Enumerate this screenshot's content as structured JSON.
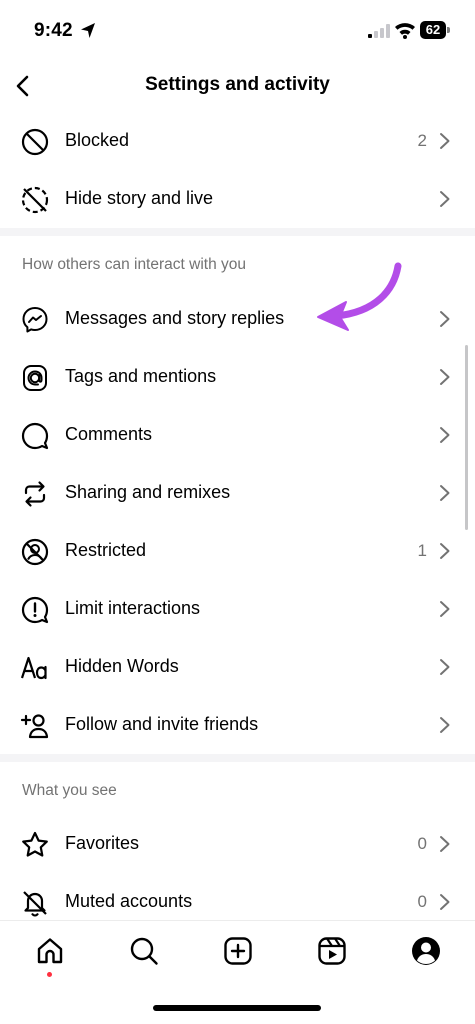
{
  "status_bar": {
    "time": "9:42",
    "battery": "62"
  },
  "header": {
    "title": "Settings and activity"
  },
  "top_rows": [
    {
      "label": "Blocked",
      "count": "2",
      "icon": "blocked-icon"
    },
    {
      "label": "Hide story and live",
      "count": "",
      "icon": "hide-story-icon"
    }
  ],
  "sections": [
    {
      "title": "How others can interact with you",
      "items": [
        {
          "label": "Messages and story replies",
          "count": "",
          "icon": "messenger-icon"
        },
        {
          "label": "Tags and mentions",
          "count": "",
          "icon": "at-sign-icon"
        },
        {
          "label": "Comments",
          "count": "",
          "icon": "comment-bubble-icon"
        },
        {
          "label": "Sharing and remixes",
          "count": "",
          "icon": "repost-icon"
        },
        {
          "label": "Restricted",
          "count": "1",
          "icon": "restricted-icon"
        },
        {
          "label": "Limit interactions",
          "count": "",
          "icon": "exclamation-circle-icon"
        },
        {
          "label": "Hidden Words",
          "count": "",
          "icon": "text-aa-icon"
        },
        {
          "label": "Follow and invite friends",
          "count": "",
          "icon": "add-person-icon"
        }
      ]
    },
    {
      "title": "What you see",
      "items": [
        {
          "label": "Favorites",
          "count": "0",
          "icon": "star-icon"
        },
        {
          "label": "Muted accounts",
          "count": "0",
          "icon": "muted-bell-icon"
        }
      ]
    }
  ],
  "tabbar": {
    "tabs": [
      "home-icon",
      "search-icon",
      "create-icon",
      "reels-icon",
      "profile-icon"
    ]
  },
  "colors": {
    "accent_arrow": "#b34de8",
    "notification_dot": "#ff3040",
    "secondary_text": "#737373"
  }
}
